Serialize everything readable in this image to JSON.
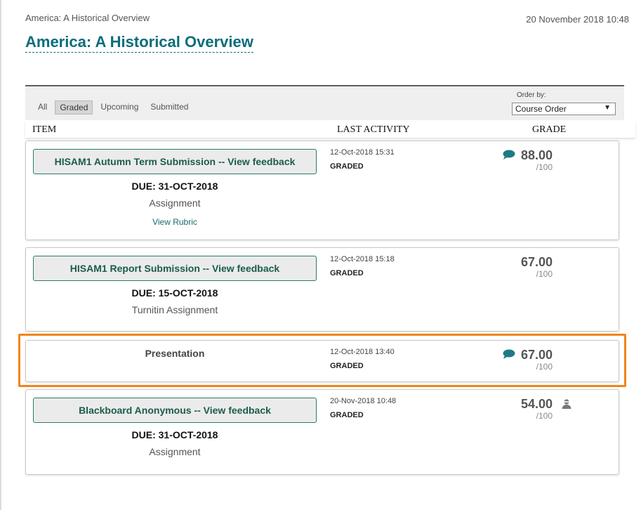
{
  "breadcrumb": "America: A Historical Overview",
  "timestamp": "20 November 2018 10:48",
  "page_title": "America: A Historical Overview",
  "filters": {
    "all": "All",
    "graded": "Graded",
    "upcoming": "Upcoming",
    "submitted": "Submitted",
    "active": "Graded"
  },
  "order": {
    "label": "Order by:",
    "selected": "Course Order"
  },
  "columns": {
    "item": "ITEM",
    "last_activity": "LAST ACTIVITY",
    "grade": "GRADE"
  },
  "items": [
    {
      "button": "HISAM1 Autumn Term Submission -- View feedback",
      "due": "DUE: 31-OCT-2018",
      "type": "Assignment",
      "rubric": "View Rubric",
      "activity_date": "12-Oct-2018 15:31",
      "status": "GRADED",
      "grade": "88.00",
      "max": "/100",
      "has_comment": true
    },
    {
      "button": "HISAM1 Report Submission -- View feedback",
      "due": "DUE: 15-OCT-2018",
      "type": "Turnitin Assignment",
      "activity_date": "12-Oct-2018 15:18",
      "status": "GRADED",
      "grade": "67.00",
      "max": "/100",
      "has_comment": false
    },
    {
      "name": "Presentation",
      "activity_date": "12-Oct-2018 13:40",
      "status": "GRADED",
      "grade": "67.00",
      "max": "/100",
      "has_comment": true,
      "highlighted": true
    },
    {
      "button": "Blackboard Anonymous -- View feedback",
      "due": "DUE: 31-OCT-2018",
      "type": "Assignment",
      "activity_date": "20-Nov-2018 10:48",
      "status": "GRADED",
      "grade": "54.00",
      "max": "/100",
      "anonymous": true
    }
  ],
  "colors": {
    "title": "#0a6d7a",
    "button_text": "#1a5c4c",
    "comment_icon": "#1f7a86",
    "highlight": "#f0851a"
  },
  "icons": {
    "comment": "comment-bubble-icon",
    "anonymous": "anonymous-user-icon"
  }
}
